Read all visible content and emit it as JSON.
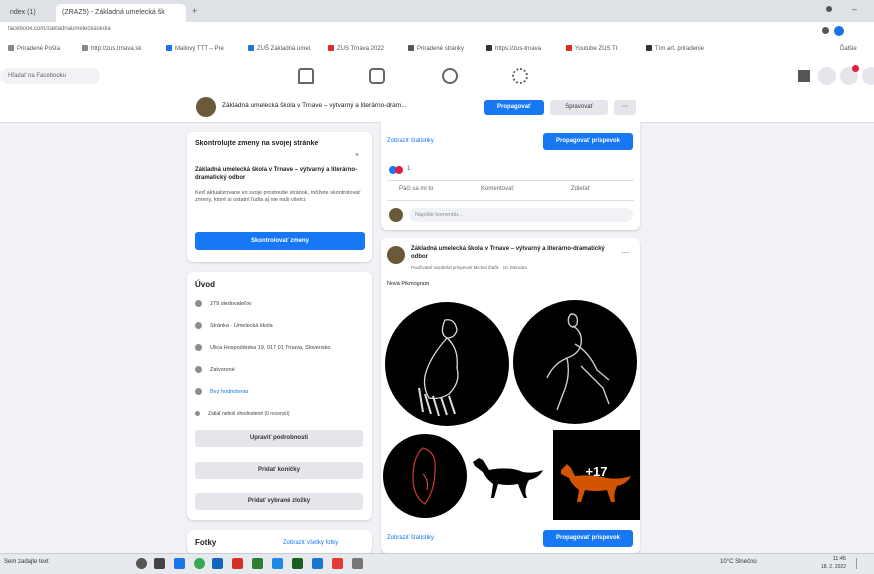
{
  "browser": {
    "tabs": [
      {
        "label": "ndex (1)"
      },
      {
        "label": "(ZRAZ5) - Základná umelecká šk"
      }
    ],
    "url": "facebook.com/zakladnaumeleckaskola",
    "bookmarks": [
      {
        "label": "Priradené Pošta",
        "color": "#888"
      },
      {
        "label": "http://zus.trnava.sk",
        "color": "#888"
      },
      {
        "label": "Mailový TTT – Pre",
        "color": "#1a73e8"
      },
      {
        "label": "ZUŠ Základná umel.",
        "color": "#1a73e8"
      },
      {
        "label": "ZUS Trnava 2022",
        "color": "#d93025"
      },
      {
        "label": "Priradené stránky",
        "color": "#555"
      },
      {
        "label": "https://zus-trnava",
        "color": "#333"
      },
      {
        "label": "Youtube ZUS Tt",
        "color": "#d93025"
      },
      {
        "label": "Tím art. priradenie",
        "color": "#333"
      }
    ],
    "right_label": "Ďalšie"
  },
  "fbnav": {
    "search_placeholder": "Hľadať na Facebooku"
  },
  "page_header": {
    "title": "Základná umelecká škola v Trnave – výtvarný a literárno-dram...",
    "promote_label": "Propagovať",
    "manage_label": "Spravovať",
    "more_label": "⋯"
  },
  "promo": {
    "title": "Skontrolujte zmeny na svojej stránke",
    "headline": "Základná umelecká škola v Trnave – výtvarný a literárno-dramatický odbor",
    "body": "Keď aktualizovane vo svoje prostredie stránok, môžete skontrolovať zmeny, ktoré si ostatní ľudia aj nie naši všetci.",
    "button": "Skontrolovať zmeny"
  },
  "intro": {
    "title": "Úvod",
    "rows": [
      "279 sledovateľov",
      "Stránka · Umelecká škola",
      "Ulica Hospodárska 19, 917 01 Trnava, Slovensko",
      "Zatvorené",
      "Bez hodnotenia",
      "Zatiaľ neboli ohodnotené (0 recenzií)"
    ],
    "buttons": [
      "Upraviť podrobnosti",
      "Pridať koníčky",
      "Pridať vybrané zložky"
    ]
  },
  "photos": {
    "title": "Fotky",
    "link": "Zobraziť všetky fotky"
  },
  "feed": {
    "insights_link": "Zobraziť štatistiky",
    "promote_post": "Propagovať príspevok",
    "reaction_count": "1",
    "actions": [
      "Páči sa mi to",
      "Komentovať",
      "Zdieľať"
    ],
    "comment_placeholder": "Napíšte komentár...",
    "post": {
      "author": "Základná umelecká škola v Trnave – výtvarný a literárno-dramatický odbor",
      "meta": "Používateľ nazdieľal príspevok Michal Žiačk · 10. februára",
      "text": "Nová Pikmogram",
      "photo_extra": "+17"
    }
  },
  "taskbar": {
    "search": "Sem zadajte text",
    "weather": "10°C Slnečno",
    "time": "11:45",
    "date": "18. 2. 2022"
  }
}
